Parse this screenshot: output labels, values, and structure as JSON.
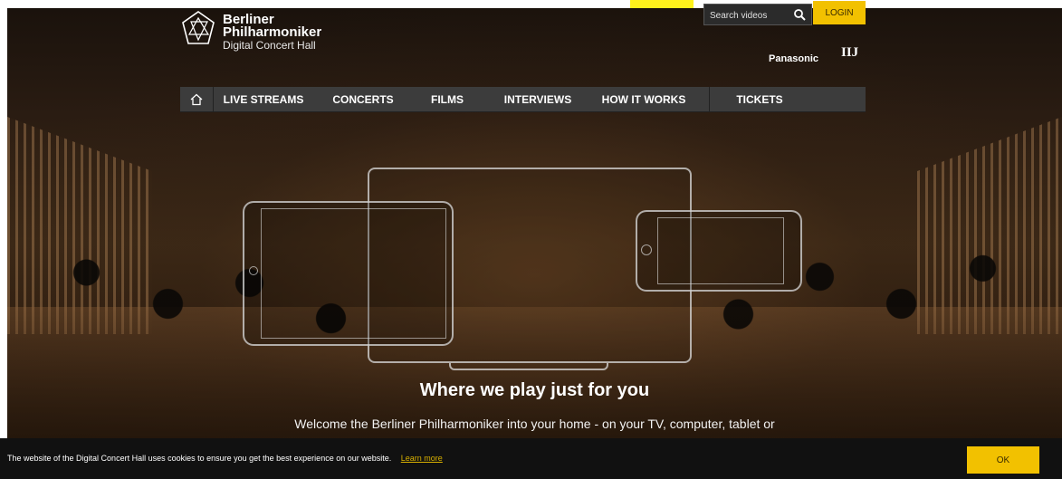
{
  "brand": {
    "line1": "Berliner",
    "line2": "Philharmoniker",
    "line3": "Digital Concert Hall"
  },
  "header": {
    "search_placeholder": "Search videos",
    "login_label": "LOGIN",
    "sponsors": [
      "Panasonic",
      "IIJ"
    ]
  },
  "nav": {
    "home_icon": "home-icon",
    "items": [
      "LIVE STREAMS",
      "CONCERTS",
      "FILMS",
      "INTERVIEWS",
      "HOW IT WORKS",
      "TICKETS"
    ]
  },
  "hero": {
    "heading": "Where we play just for you",
    "text": "Welcome the Berliner Philharmoniker into your home - on your TV, computer, tablet or"
  },
  "cookie": {
    "text": "The website of the Digital Concert Hall uses cookies to ensure you get the best experience on our website.",
    "learn_more": "Learn more",
    "ok_label": "OK"
  },
  "colors": {
    "accent": "#f2c100",
    "nav_bg": "#3c3c3c",
    "highlight": "#fff21c"
  }
}
